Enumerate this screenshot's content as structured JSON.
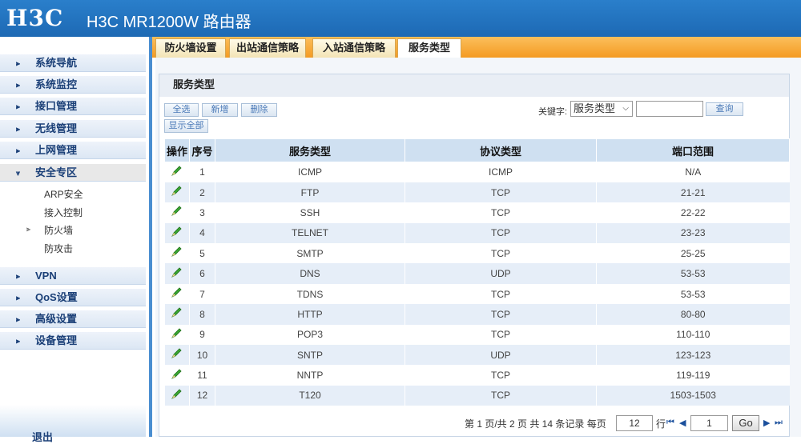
{
  "app": {
    "logo": "H3C",
    "title": "H3C MR1200W 路由器"
  },
  "sidebar": {
    "items": [
      {
        "label": "系统导航"
      },
      {
        "label": "系统监控"
      },
      {
        "label": "接口管理"
      },
      {
        "label": "无线管理"
      },
      {
        "label": "上网管理"
      },
      {
        "label": "安全专区"
      },
      {
        "label": "VPN"
      },
      {
        "label": "QoS设置"
      },
      {
        "label": "高级设置"
      },
      {
        "label": "设备管理"
      }
    ],
    "security_sub": [
      "ARP安全",
      "接入控制",
      "防火墙",
      "防攻击"
    ],
    "logout": "退出"
  },
  "tabs": [
    "防火墙设置",
    "出站通信策略",
    "入站通信策略",
    "服务类型"
  ],
  "panel": {
    "title": "服务类型",
    "buttons": {
      "select_all": "全选",
      "add": "新增",
      "delete": "删除",
      "show_all": "显示全部",
      "query": "查询"
    },
    "keyword_label": "关键字:",
    "keyword_select": "服务类型",
    "keyword_value": ""
  },
  "table": {
    "headers": [
      "操作",
      "序号",
      "服务类型",
      "协议类型",
      "端口范围"
    ],
    "rows": [
      [
        "1",
        "ICMP",
        "ICMP",
        "N/A"
      ],
      [
        "2",
        "FTP",
        "TCP",
        "21-21"
      ],
      [
        "3",
        "SSH",
        "TCP",
        "22-22"
      ],
      [
        "4",
        "TELNET",
        "TCP",
        "23-23"
      ],
      [
        "5",
        "SMTP",
        "TCP",
        "25-25"
      ],
      [
        "6",
        "DNS",
        "UDP",
        "53-53"
      ],
      [
        "7",
        "TDNS",
        "TCP",
        "53-53"
      ],
      [
        "8",
        "HTTP",
        "TCP",
        "80-80"
      ],
      [
        "9",
        "POP3",
        "TCP",
        "110-110"
      ],
      [
        "10",
        "SNTP",
        "UDP",
        "123-123"
      ],
      [
        "11",
        "NNTP",
        "TCP",
        "119-119"
      ],
      [
        "12",
        "T120",
        "TCP",
        "1503-1503"
      ]
    ]
  },
  "pager": {
    "summary": "第 1 页/共 2 页 共 14 条记录 每页",
    "per_page": "12",
    "row_unit": "行",
    "page": "1",
    "go": "Go"
  }
}
